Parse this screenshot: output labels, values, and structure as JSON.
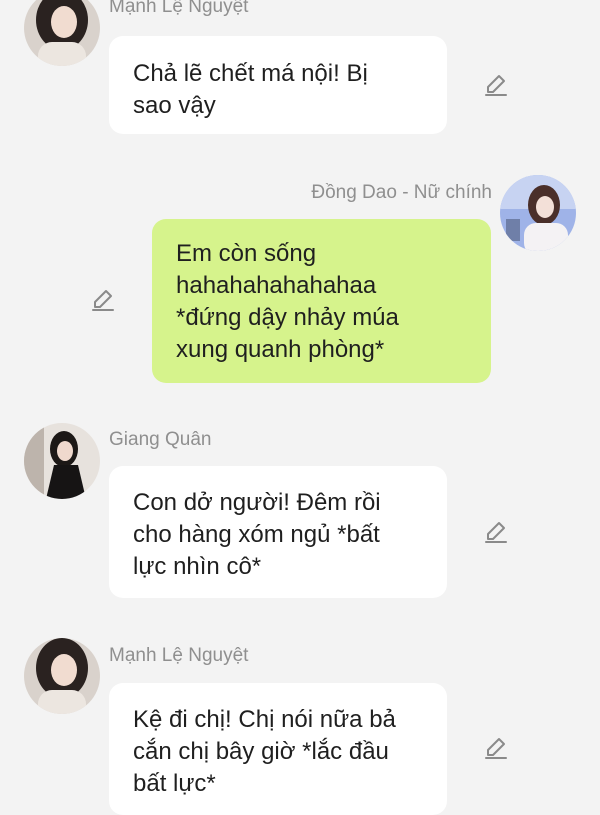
{
  "messages": [
    {
      "sender": "Mạnh Lệ Nguyệt",
      "text": "Chả lẽ chết má nội! Bị\nsao vậy",
      "direction": "incoming",
      "edit_icon": "pencil-icon"
    },
    {
      "sender": "Đồng Dao - Nữ chính",
      "text": "Em còn sống\nhahahahahahahaa\n*đứng dậy nhảy múa\nxung quanh phòng*",
      "direction": "outgoing",
      "edit_icon": "pencil-icon"
    },
    {
      "sender": "Giang Quân",
      "text": "Con dở người! Đêm rồi\ncho hàng xóm ngủ *bất\nlực nhìn cô*",
      "direction": "incoming",
      "edit_icon": "pencil-icon"
    },
    {
      "sender": "Mạnh Lệ Nguyệt",
      "text": "Kệ đi chị! Chị nói nữa bả\ncắn chị bây giờ *lắc đầu\nbất lực*",
      "direction": "incoming",
      "edit_icon": "pencil-icon"
    }
  ],
  "colors": {
    "background": "#f3f3f3",
    "incoming_bubble": "#ffffff",
    "outgoing_bubble": "#d6f38c",
    "name_text": "#8f8f8f"
  }
}
